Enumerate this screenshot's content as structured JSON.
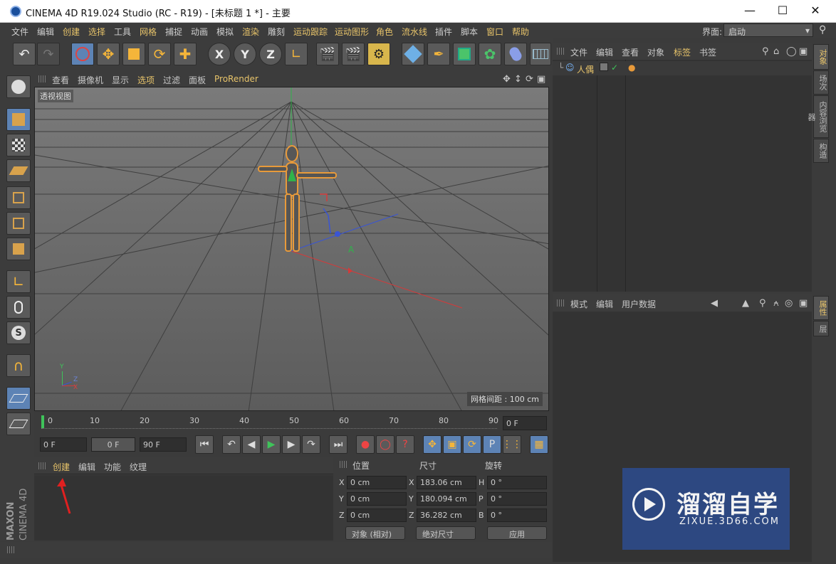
{
  "window": {
    "title": "CINEMA 4D R19.024 Studio (RC - R19) - [未标题 1 *] - 主要"
  },
  "menu": [
    "文件",
    "编辑",
    "创建",
    "选择",
    "工具",
    "网格",
    "捕捉",
    "动画",
    "模拟",
    "渲染",
    "雕刻",
    "运动跟踪",
    "运动图形",
    "角色",
    "流水线",
    "插件",
    "脚本",
    "窗口",
    "帮助"
  ],
  "menu_highlight": [
    "创建",
    "选择",
    "网格",
    "渲染",
    "运动跟踪",
    "运动图形",
    "角色",
    "流水线",
    "窗口",
    "帮助"
  ],
  "interface": {
    "label": "界面:",
    "value": "启动"
  },
  "viewport": {
    "menu": [
      "查看",
      "摄像机",
      "显示",
      "选项",
      "过滤",
      "面板",
      "ProRender"
    ],
    "active_menu": "选项",
    "label": "透视视图",
    "grid_label": "网格间距 : 100 cm",
    "axis_x": "X",
    "axis_y": "Y",
    "axis_z": "Z"
  },
  "timeline": {
    "ticks": [
      "0",
      "10",
      "20",
      "30",
      "40",
      "50",
      "60",
      "70",
      "80",
      "90"
    ],
    "frame_field": "0 F"
  },
  "transport": {
    "start": "0 F",
    "current": "0 F",
    "end": "90 F"
  },
  "material": {
    "tabs": [
      "创建",
      "编辑",
      "功能",
      "纹理"
    ],
    "active": "创建"
  },
  "coords": {
    "headers": [
      "位置",
      "尺寸",
      "旋转"
    ],
    "rows": [
      {
        "a": "X",
        "pos": "0 cm",
        "b": "X",
        "size": "183.06 cm",
        "c": "H",
        "rot": "0 °"
      },
      {
        "a": "Y",
        "pos": "0 cm",
        "b": "Y",
        "size": "180.094 cm",
        "c": "P",
        "rot": "0 °"
      },
      {
        "a": "Z",
        "pos": "0 cm",
        "b": "Z",
        "size": "36.282 cm",
        "c": "B",
        "rot": "0 °"
      }
    ],
    "mode": "对象 (相对)",
    "size_mode": "绝对尺寸",
    "apply": "应用"
  },
  "objects": {
    "menu": [
      "文件",
      "编辑",
      "查看",
      "对象",
      "标签",
      "书签"
    ],
    "items": [
      {
        "name": "人偶"
      }
    ]
  },
  "attributes": {
    "menu": [
      "模式",
      "编辑",
      "用户数据"
    ]
  },
  "side_tabs_top": [
    "对象",
    "场次",
    "内容浏览器",
    "构造"
  ],
  "side_tabs_bottom": [
    "属性",
    "层"
  ],
  "brand": {
    "maxon": "MAXON",
    "c4d": "CINEMA 4D"
  },
  "watermark": {
    "text": "溜溜自学",
    "url": "ZIXUE.3D66.COM"
  },
  "colors": {
    "accent": "#e8c46a",
    "active_blue": "#5d83b5",
    "viewport": "#6a6a6a"
  }
}
